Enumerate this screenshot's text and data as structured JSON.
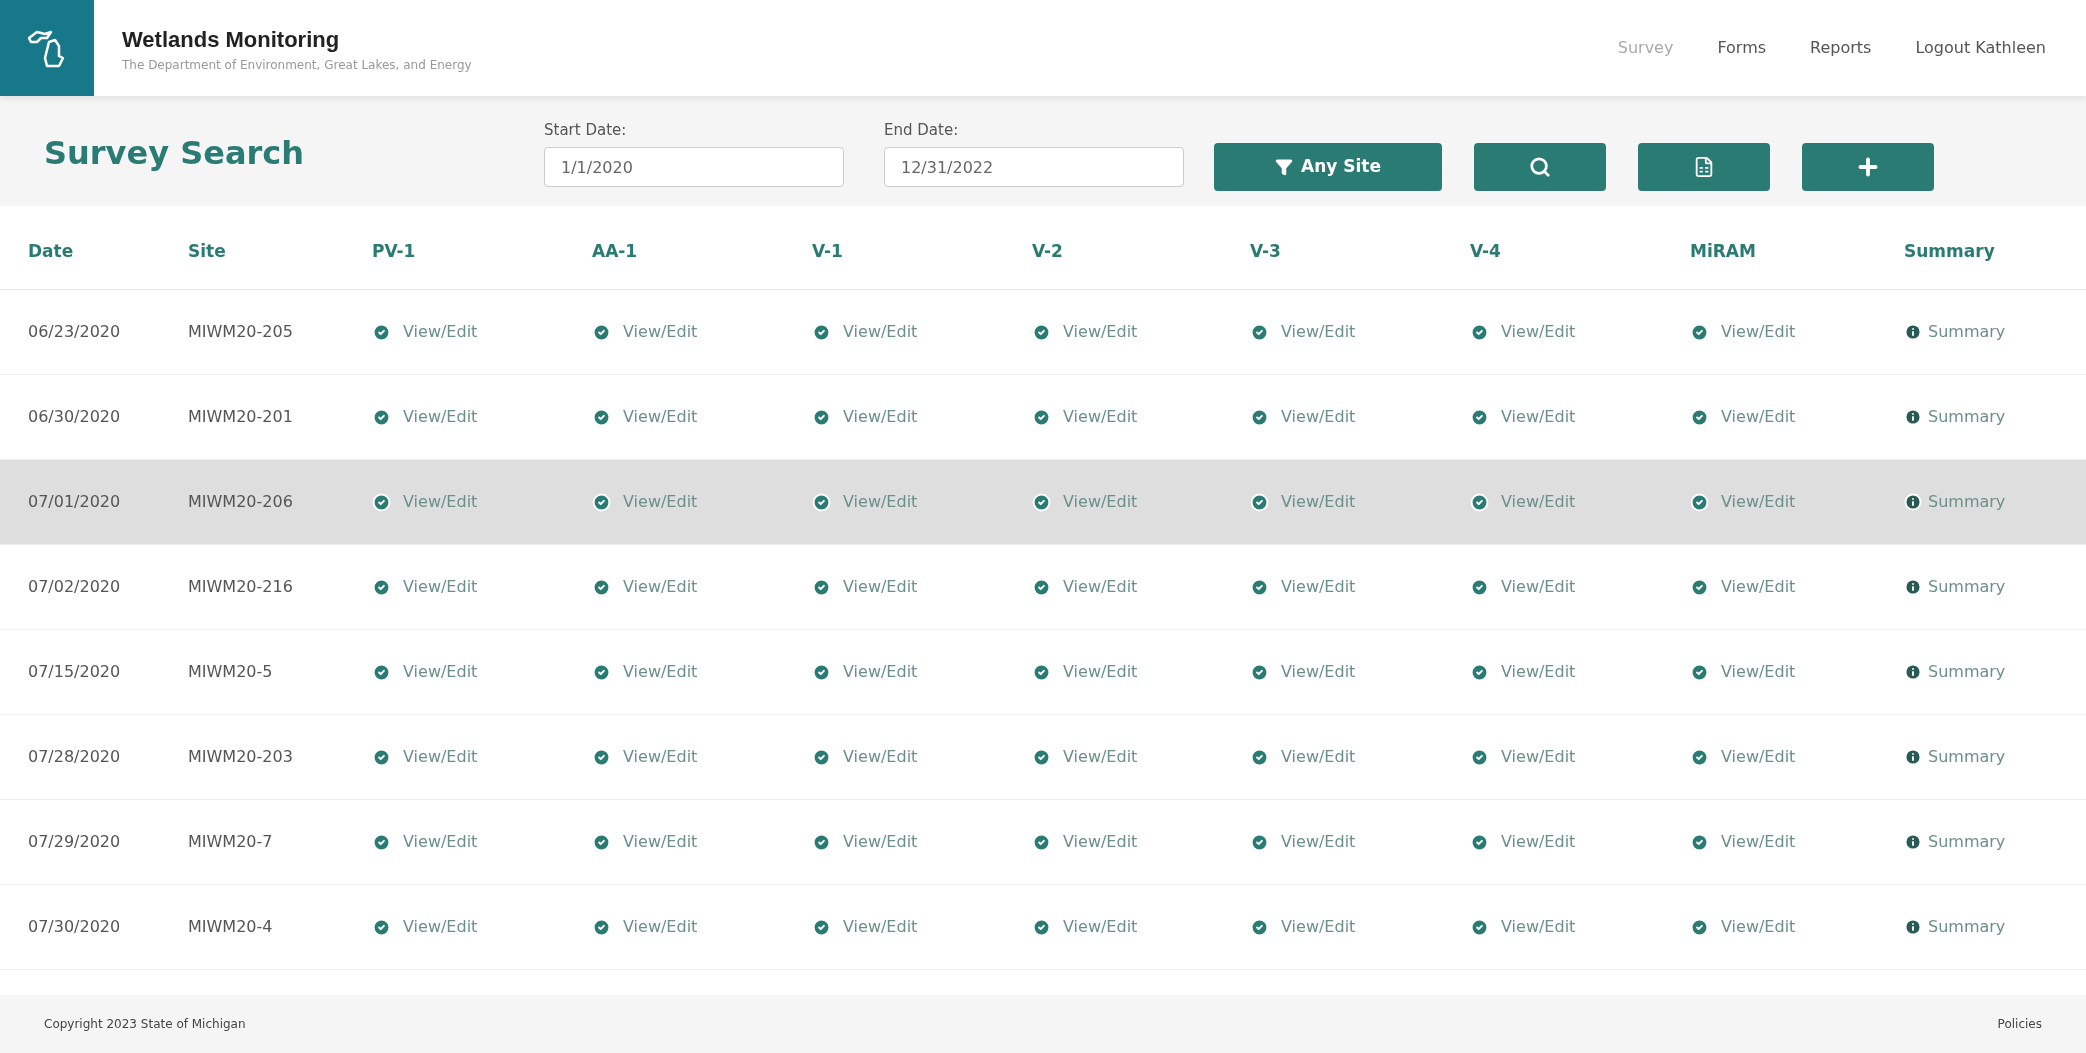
{
  "header": {
    "title": "Wetlands Monitoring",
    "subtitle": "The Department of Environment, Great Lakes, and Energy"
  },
  "nav": [
    {
      "label": "Survey",
      "selected": true
    },
    {
      "label": "Forms",
      "selected": false
    },
    {
      "label": "Reports",
      "selected": false
    },
    {
      "label": "Logout Kathleen",
      "selected": false
    }
  ],
  "toolbar": {
    "title": "Survey Search",
    "start_date": {
      "label": "Start Date:",
      "value": "1/1/2020"
    },
    "end_date": {
      "label": "End Date:",
      "value": "12/31/2022"
    },
    "buttons": [
      {
        "kind": "filter",
        "label": "Any Site"
      },
      {
        "kind": "search"
      },
      {
        "kind": "excel"
      },
      {
        "kind": "add"
      }
    ]
  },
  "table": {
    "columns": [
      "Date",
      "Site",
      "PV-1",
      "AA-1",
      "V-1",
      "V-2",
      "V-3",
      "V-4",
      "MiRAM",
      "Summary"
    ],
    "rows": [
      {
        "date": "06/23/2020",
        "site": "MIWM20-205",
        "selected": false,
        "links": [
          {
            "kind": "form",
            "label": "View/Edit"
          },
          {
            "kind": "form",
            "label": "View/Edit"
          },
          {
            "kind": "form",
            "label": "View/Edit"
          },
          {
            "kind": "form",
            "label": "View/Edit"
          },
          {
            "kind": "form",
            "label": "View/Edit"
          },
          {
            "kind": "form",
            "label": "View/Edit"
          },
          {
            "kind": "form",
            "label": "View/Edit"
          },
          {
            "kind": "summary",
            "label": "Summary"
          }
        ]
      },
      {
        "date": "06/30/2020",
        "site": "MIWM20-201",
        "selected": false,
        "links": [
          {
            "kind": "form",
            "label": "View/Edit"
          },
          {
            "kind": "form",
            "label": "View/Edit"
          },
          {
            "kind": "form",
            "label": "View/Edit"
          },
          {
            "kind": "form",
            "label": "View/Edit"
          },
          {
            "kind": "form",
            "label": "View/Edit"
          },
          {
            "kind": "form",
            "label": "View/Edit"
          },
          {
            "kind": "form",
            "label": "View/Edit"
          },
          {
            "kind": "summary",
            "label": "Summary"
          }
        ]
      },
      {
        "date": "07/01/2020",
        "site": "MIWM20-206",
        "selected": true,
        "links": [
          {
            "kind": "form",
            "label": "View/Edit"
          },
          {
            "kind": "form",
            "label": "View/Edit"
          },
          {
            "kind": "form",
            "label": "View/Edit"
          },
          {
            "kind": "form",
            "label": "View/Edit"
          },
          {
            "kind": "form",
            "label": "View/Edit"
          },
          {
            "kind": "form",
            "label": "View/Edit"
          },
          {
            "kind": "form",
            "label": "View/Edit"
          },
          {
            "kind": "summary",
            "label": "Summary"
          }
        ]
      },
      {
        "date": "07/02/2020",
        "site": "MIWM20-216",
        "selected": false,
        "links": [
          {
            "kind": "form",
            "label": "View/Edit"
          },
          {
            "kind": "form",
            "label": "View/Edit"
          },
          {
            "kind": "form",
            "label": "View/Edit"
          },
          {
            "kind": "form",
            "label": "View/Edit"
          },
          {
            "kind": "form",
            "label": "View/Edit"
          },
          {
            "kind": "form",
            "label": "View/Edit"
          },
          {
            "kind": "form",
            "label": "View/Edit"
          },
          {
            "kind": "summary",
            "label": "Summary"
          }
        ]
      },
      {
        "date": "07/15/2020",
        "site": "MIWM20-5",
        "selected": false,
        "links": [
          {
            "kind": "form",
            "label": "View/Edit"
          },
          {
            "kind": "form",
            "label": "View/Edit"
          },
          {
            "kind": "form",
            "label": "View/Edit"
          },
          {
            "kind": "form",
            "label": "View/Edit"
          },
          {
            "kind": "form",
            "label": "View/Edit"
          },
          {
            "kind": "form",
            "label": "View/Edit"
          },
          {
            "kind": "form",
            "label": "View/Edit"
          },
          {
            "kind": "summary",
            "label": "Summary"
          }
        ]
      },
      {
        "date": "07/28/2020",
        "site": "MIWM20-203",
        "selected": false,
        "links": [
          {
            "kind": "form",
            "label": "View/Edit"
          },
          {
            "kind": "form",
            "label": "View/Edit"
          },
          {
            "kind": "form",
            "label": "View/Edit"
          },
          {
            "kind": "form",
            "label": "View/Edit"
          },
          {
            "kind": "form",
            "label": "View/Edit"
          },
          {
            "kind": "form",
            "label": "View/Edit"
          },
          {
            "kind": "form",
            "label": "View/Edit"
          },
          {
            "kind": "summary",
            "label": "Summary"
          }
        ]
      },
      {
        "date": "07/29/2020",
        "site": "MIWM20-7",
        "selected": false,
        "links": [
          {
            "kind": "form",
            "label": "View/Edit"
          },
          {
            "kind": "form",
            "label": "View/Edit"
          },
          {
            "kind": "form",
            "label": "View/Edit"
          },
          {
            "kind": "form",
            "label": "View/Edit"
          },
          {
            "kind": "form",
            "label": "View/Edit"
          },
          {
            "kind": "form",
            "label": "View/Edit"
          },
          {
            "kind": "form",
            "label": "View/Edit"
          },
          {
            "kind": "summary",
            "label": "Summary"
          }
        ]
      },
      {
        "date": "07/30/2020",
        "site": "MIWM20-4",
        "selected": false,
        "links": [
          {
            "kind": "form",
            "label": "View/Edit"
          },
          {
            "kind": "form",
            "label": "View/Edit"
          },
          {
            "kind": "form",
            "label": "View/Edit"
          },
          {
            "kind": "form",
            "label": "View/Edit"
          },
          {
            "kind": "form",
            "label": "View/Edit"
          },
          {
            "kind": "form",
            "label": "View/Edit"
          },
          {
            "kind": "form",
            "label": "View/Edit"
          },
          {
            "kind": "summary",
            "label": "Summary"
          }
        ]
      }
    ]
  },
  "footer": {
    "copyright": "Copyright 2023 State of Michigan",
    "link": "Policies"
  }
}
